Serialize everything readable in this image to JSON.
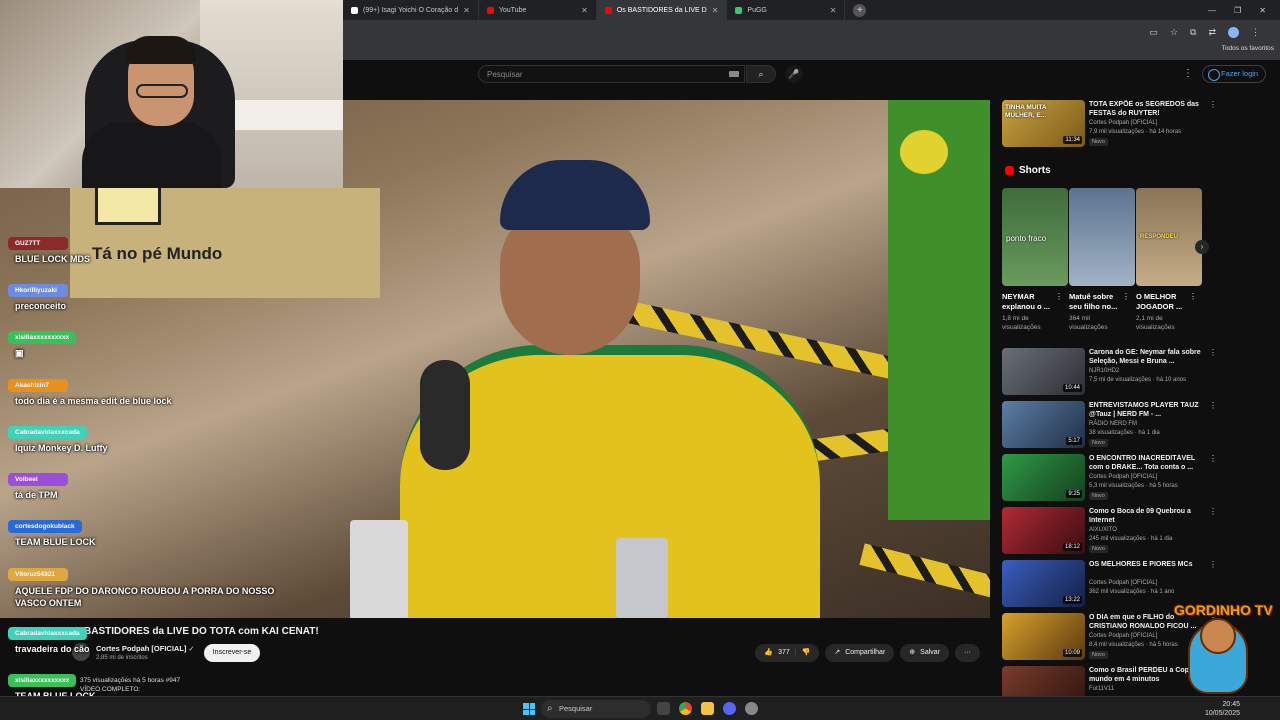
{
  "browser": {
    "tabs": [
      {
        "label": "(99+) Isagi Yoichi O Coração d",
        "active": false
      },
      {
        "label": "YouTube",
        "active": false
      },
      {
        "label": "Os BASTIDORES da LIVE D",
        "active": true
      },
      {
        "label": "PuGG",
        "active": false
      }
    ],
    "new_tab": "+",
    "window_controls": [
      "—",
      "❐",
      "✕"
    ],
    "favorites_label": "Todos os favoritos"
  },
  "youtube": {
    "search_placeholder": "Pesquisar",
    "search_button": "⌕",
    "mic": "🎤",
    "kebab": "⋮",
    "login_label": "Fazer login"
  },
  "video": {
    "title": "BASTIDORES da LIVE DO TOTA com KAI CENAT!",
    "channel": "Cortes Podpah [OFICIAL]",
    "verified": "✓",
    "subscribers": "2,85 mi de inscritos",
    "subscribe_label": "Inscrever-se",
    "likes": "377",
    "like_icon": "👍",
    "dislike_icon": "👎",
    "share_label": "Compartilhar",
    "save_label": "Salvar",
    "more_label": "···",
    "views_line": "375 visualizações  há 5 horas  #947",
    "desc_line2": "VÍDEO COMPLETO:",
    "scene_text": "Tá no pé Mundo",
    "panel_text": "PODPAH"
  },
  "chat": [
    {
      "user": "GUZ7TT",
      "color": "#8c2a2a",
      "msg": "BLUE LOCK MDS"
    },
    {
      "user": "Hkorilliyuzaki",
      "color": "#6d8be0",
      "msg": "preconceito"
    },
    {
      "user": "xisiliaxxxxxxxxxx",
      "color": "#39c05a",
      "msg": ""
    },
    {
      "user": "Akashizin7",
      "color": "#e8901f",
      "msg": "todo dia é a mesma edit de blue lock"
    },
    {
      "user": "Cabradavidaxxxcada",
      "color": "#3fd2b8",
      "msg": "Iquiz Monkey D. Luffy"
    },
    {
      "user": "Volbeel",
      "color": "#9b4fd9",
      "msg": "tá de TPM"
    },
    {
      "user": "cortesdogokublack",
      "color": "#2a6ad8",
      "msg": "TEAM BLUE LOCK"
    },
    {
      "user": "Vitoruz54321",
      "color": "#e0a640",
      "msg": "AQUELE FDP DO DARONCO ROUBOU A PORRA DO NOSSO VASCO ONTEM"
    },
    {
      "user": "Cabradavidaxxxcada",
      "color": "#3fd2b8",
      "msg": "travadeira do cão"
    },
    {
      "user": "xisiliaxxxxxxxxxx",
      "color": "#39c05a",
      "msg": "TEAM BLUE LOCK"
    }
  ],
  "sidebar": {
    "top_rec": {
      "title": "TOTA EXPÕE os SEGREDOS das FESTAS do RUYTER!",
      "channel": "Cortes Podpah [OFICIAL]",
      "stats": "7,9 mil visualizações · há 14 horas",
      "duration": "11:34",
      "new": "Novo",
      "thumb_text": "TINHA MUITA MULHER, E...",
      "color": "#c8a23c"
    },
    "shorts_label": "Shorts",
    "next_icon": "›",
    "shorts": [
      {
        "title": "NEYMAR explanou o ...",
        "views": "1,8 mi de visualizações",
        "overlay": "ponto fraco",
        "color": "#4f7a4a"
      },
      {
        "title": "Matuê sobre seu filho no...",
        "views": "364 mil visualizações",
        "overlay": "",
        "color": "#7a8ea3"
      },
      {
        "title": "O MELHOR JOGADOR ...",
        "views": "2,1 mi de visualizações",
        "overlay": "RESPONDEU",
        "color": "#a58f6c"
      }
    ],
    "recs": [
      {
        "title": "Carona do GE: Neymar fala sobre Seleção, Messi e Bruna ...",
        "channel": "NJR10HD2",
        "stats": "7,5 mi de visualizações · há 10 anos",
        "duration": "10:44",
        "new": "",
        "color": "#6a6f78"
      },
      {
        "title": "ENTREVISTAMOS PLAYER TAUZ @Tauz | NERD FM - ...",
        "channel": "RÁDIO NERD FM",
        "stats": "38 visualizações · há 1 dia",
        "duration": "5:17",
        "new": "Novo",
        "color": "#5b7fa8"
      },
      {
        "title": "O ENCONTRO INACREDITÁVEL com o DRAKE... Tota conta o ...",
        "channel": "Cortes Podpah [OFICIAL]",
        "stats": "5,3 mil visualizações · há 5 horas",
        "duration": "9:25",
        "new": "Novo",
        "color": "#2f9a46"
      },
      {
        "title": "Como o Boca de 09 Quebrou a Internet",
        "channel": "AIXUXITO",
        "stats": "245 mil visualizações · há 1 dia",
        "duration": "18:12",
        "new": "Novo",
        "color": "#b22a35"
      },
      {
        "title": "OS MELHORES E PIORES MCs",
        "channel": "Cortes Podpah [OFICIAL]",
        "stats": "362 mil visualizações · há 1 ano",
        "duration": "13:22",
        "new": "",
        "color": "#3a5fc0"
      },
      {
        "title": "O DIA em que o FILHO do CRISTIANO RONALDO FICOU ...",
        "channel": "Cortes Podpah [OFICIAL]",
        "stats": "8,4 mil visualizações · há 5 horas",
        "duration": "10:09",
        "new": "Novo",
        "color": "#d9a12b"
      },
      {
        "title": "Como o Brasil PERDEU a Copa do mundo em 4 minutos",
        "channel": "Fut11V11",
        "stats": "",
        "duration": "",
        "new": "",
        "color": "#7a3b2c"
      }
    ]
  },
  "taskbar": {
    "search_placeholder": "Pesquisar",
    "time": "20:45",
    "date": "10/05/2025"
  },
  "mascot": {
    "label": "GORDINHO TV"
  }
}
